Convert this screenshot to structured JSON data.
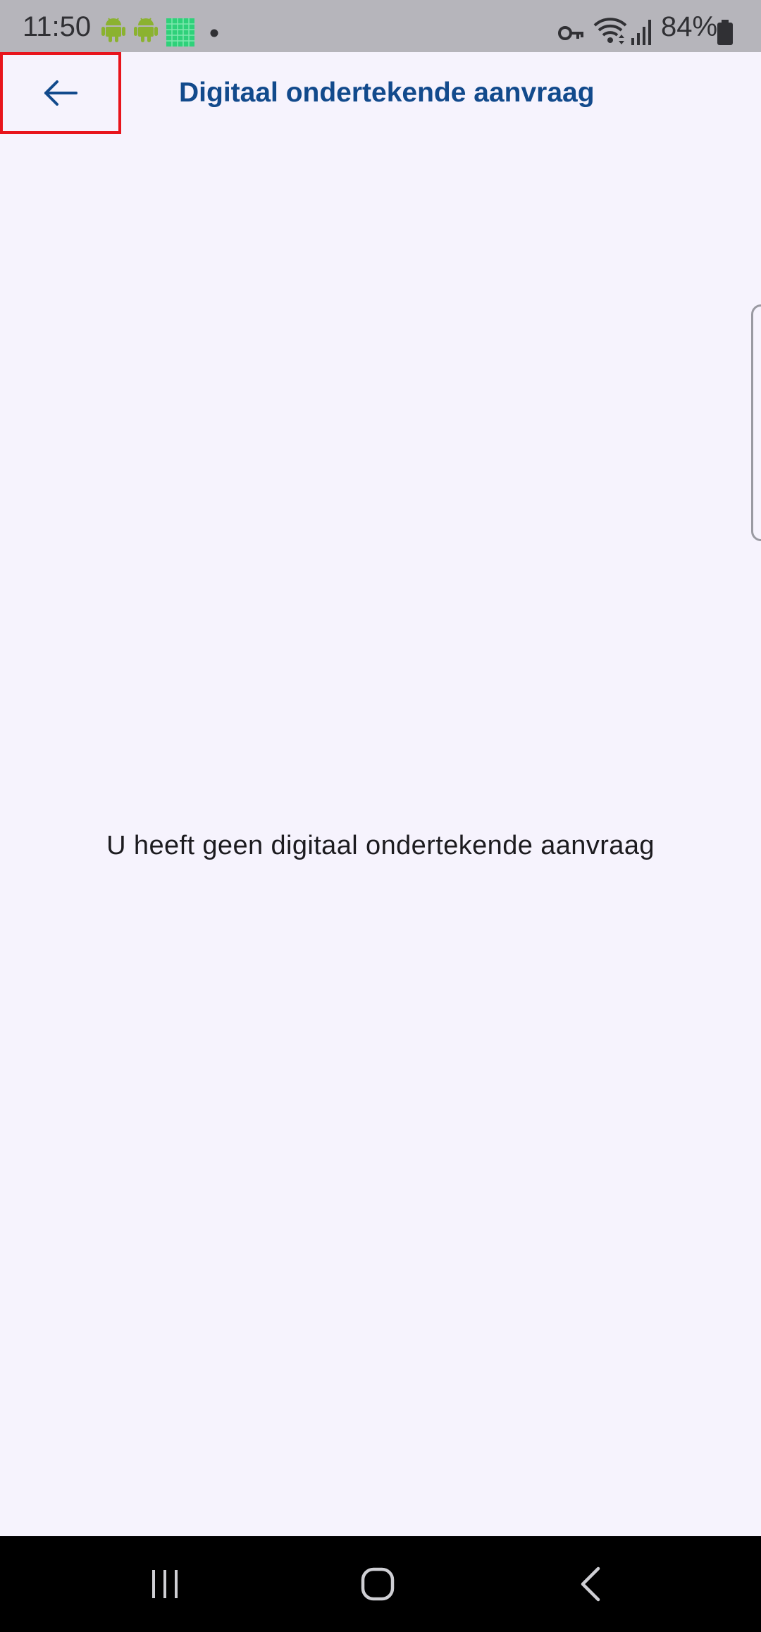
{
  "status_bar": {
    "time": "11:50",
    "battery": "84%",
    "icons": [
      "android-icon",
      "android-icon",
      "grid-app-icon",
      "dot-icon",
      "key-icon",
      "wifi-icon",
      "signal-icon",
      "battery-icon"
    ]
  },
  "app_bar": {
    "back_icon": "arrow-back-icon",
    "title": "Digitaal ondertekende aanvraag"
  },
  "content": {
    "empty_message": "U heeft geen digitaal ondertekende aanvraag"
  },
  "nav_bar": {
    "icons": [
      "recent-apps-icon",
      "home-icon",
      "back-icon"
    ]
  },
  "colors": {
    "background": "#f6f3fd",
    "title": "#124a8c",
    "highlight_border": "#e8141c",
    "status_bar": "#b6b5bb",
    "nav_bar": "#000000"
  }
}
